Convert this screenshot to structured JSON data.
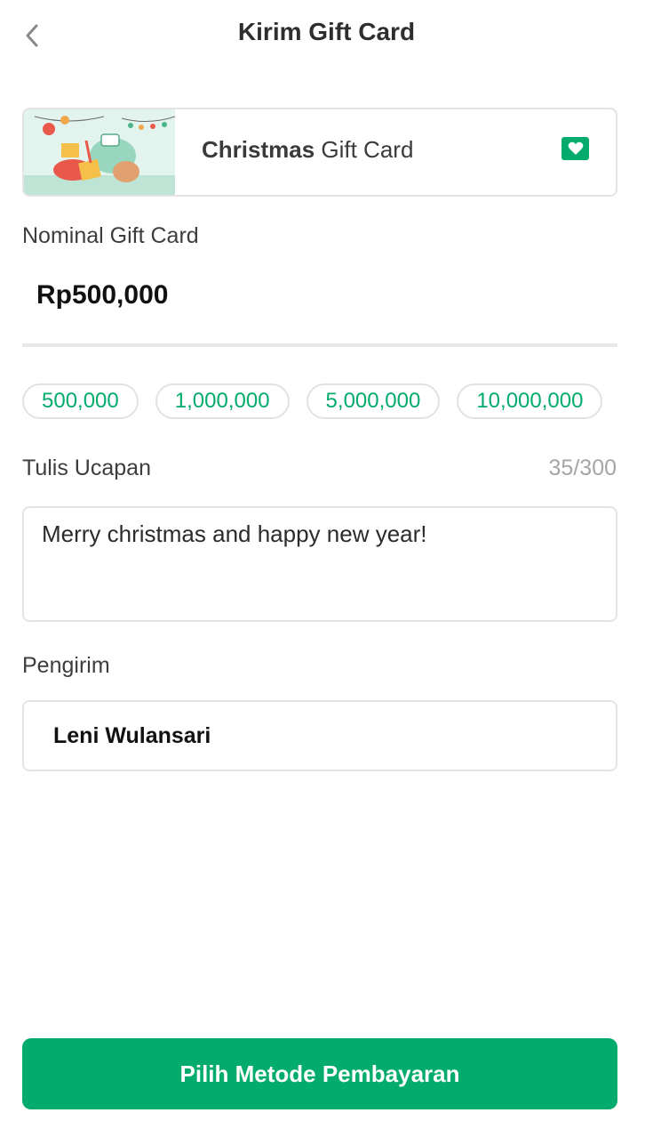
{
  "header": {
    "title": "Kirim Gift Card"
  },
  "gift_card": {
    "title_bold": "Christmas",
    "title_rest": " Gift Card",
    "badge_icon": "heart-icon"
  },
  "nominal": {
    "label": "Nominal Gift Card",
    "value": "Rp500,000",
    "options": [
      "500,000",
      "1,000,000",
      "5,000,000",
      "10,000,000"
    ]
  },
  "message": {
    "label": "Tulis Ucapan",
    "counter": "35/300",
    "value": "Merry christmas and happy new year!"
  },
  "sender": {
    "label": "Pengirim",
    "value": "Leni Wulansari"
  },
  "footer": {
    "button_label": "Pilih Metode Pembayaran"
  },
  "colors": {
    "accent": "#03ac6d"
  }
}
